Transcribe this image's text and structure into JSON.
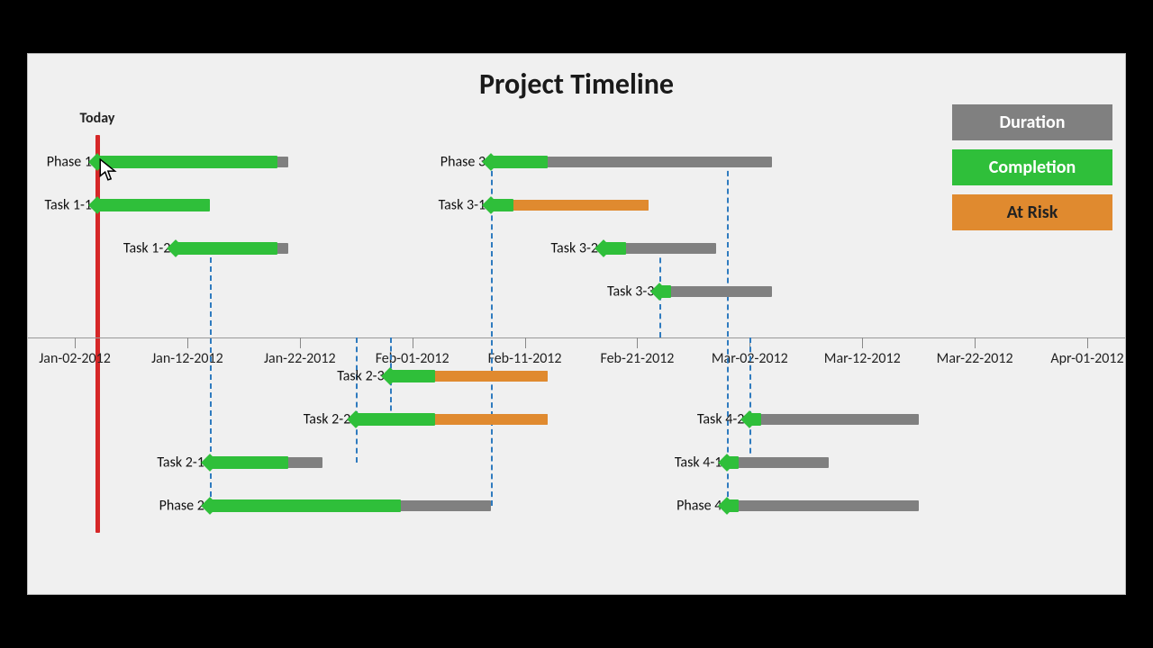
{
  "title": "Project Timeline",
  "today_label": "Today",
  "legend": {
    "duration": {
      "label": "Duration",
      "color": "#808080"
    },
    "completion": {
      "label": "Completion",
      "color": "#2fbf3a"
    },
    "atrisk": {
      "label": "At Risk",
      "color": "#e08a2f"
    }
  },
  "colors": {
    "duration": "#808080",
    "completion": "#2fbf3a",
    "atrisk": "#e08a2f",
    "diamond": "#2fbf3a",
    "today": "#d62728"
  },
  "chart_data": {
    "type": "gantt",
    "x_axis": {
      "min": "2012-01-02",
      "max": "2012-04-01",
      "ticks": [
        "Jan-02-2012",
        "Jan-12-2012",
        "Jan-22-2012",
        "Feb-01-2012",
        "Feb-11-2012",
        "Feb-21-2012",
        "Mar-02-2012",
        "Mar-12-2012",
        "Mar-22-2012",
        "Apr-01-2012"
      ]
    },
    "today": "2012-01-04",
    "tasks": [
      {
        "id": "phase1",
        "label": "Phase 1",
        "position": "above",
        "row": 0,
        "start": "2012-01-04",
        "end": "2012-01-21",
        "completion_end": "2012-01-20",
        "atrisk_end": null
      },
      {
        "id": "task1_1",
        "label": "Task 1-1",
        "position": "above",
        "row": 1,
        "start": "2012-01-04",
        "end": "2012-01-14",
        "completion_end": "2012-01-14",
        "atrisk_end": null
      },
      {
        "id": "task1_2",
        "label": "Task 1-2",
        "position": "above",
        "row": 2,
        "start": "2012-01-11",
        "end": "2012-01-21",
        "completion_end": "2012-01-20",
        "atrisk_end": null
      },
      {
        "id": "phase3",
        "label": "Phase 3",
        "position": "above",
        "row": 0,
        "start": "2012-02-08",
        "end": "2012-03-04",
        "completion_end": "2012-02-13",
        "atrisk_end": null
      },
      {
        "id": "task3_1",
        "label": "Task 3-1",
        "position": "above",
        "row": 1,
        "start": "2012-02-08",
        "end": "2012-02-22",
        "completion_end": "2012-02-10",
        "atrisk_end": "2012-02-22"
      },
      {
        "id": "task3_2",
        "label": "Task 3-2",
        "position": "above",
        "row": 2,
        "start": "2012-02-18",
        "end": "2012-02-28",
        "completion_end": "2012-02-20",
        "atrisk_end": null
      },
      {
        "id": "task3_3",
        "label": "Task 3-3",
        "position": "above",
        "row": 3,
        "start": "2012-02-23",
        "end": "2012-03-04",
        "completion_end": "2012-02-24",
        "atrisk_end": null
      },
      {
        "id": "task2_3",
        "label": "Task 2-3",
        "position": "below",
        "row": 0,
        "start": "2012-01-30",
        "end": "2012-02-13",
        "completion_end": "2012-02-03",
        "atrisk_end": "2012-02-13"
      },
      {
        "id": "task2_2",
        "label": "Task 2-2",
        "position": "below",
        "row": 1,
        "start": "2012-01-27",
        "end": "2012-02-13",
        "completion_end": "2012-02-03",
        "atrisk_end": "2012-02-13"
      },
      {
        "id": "task2_1",
        "label": "Task 2-1",
        "position": "below",
        "row": 2,
        "start": "2012-01-14",
        "end": "2012-01-24",
        "completion_end": "2012-01-21",
        "atrisk_end": null
      },
      {
        "id": "phase2",
        "label": "Phase 2",
        "position": "below",
        "row": 3,
        "start": "2012-01-14",
        "end": "2012-02-08",
        "completion_end": "2012-01-31",
        "atrisk_end": null
      },
      {
        "id": "task4_2",
        "label": "Task 4-2",
        "position": "below",
        "row": 1,
        "start": "2012-03-02",
        "end": "2012-03-17",
        "completion_end": "2012-03-03",
        "atrisk_end": null
      },
      {
        "id": "task4_1",
        "label": "Task 4-1",
        "position": "below",
        "row": 2,
        "start": "2012-02-29",
        "end": "2012-03-09",
        "completion_end": "2012-03-01",
        "atrisk_end": null
      },
      {
        "id": "phase4",
        "label": "Phase 4",
        "position": "below",
        "row": 3,
        "start": "2012-02-29",
        "end": "2012-03-17",
        "completion_end": "2012-03-01",
        "atrisk_end": null
      }
    ],
    "dependencies": [
      {
        "from": "task1_2",
        "to": "phase2"
      },
      {
        "from": "task2_1",
        "to": "task2_2"
      },
      {
        "from": "task2_2",
        "to": "task2_3"
      },
      {
        "from": "phase2",
        "to": "phase3"
      },
      {
        "from": "task3_2",
        "to": "task3_3"
      },
      {
        "from": "phase3",
        "to": "phase4"
      },
      {
        "from": "task4_1",
        "to": "task4_2"
      }
    ]
  }
}
